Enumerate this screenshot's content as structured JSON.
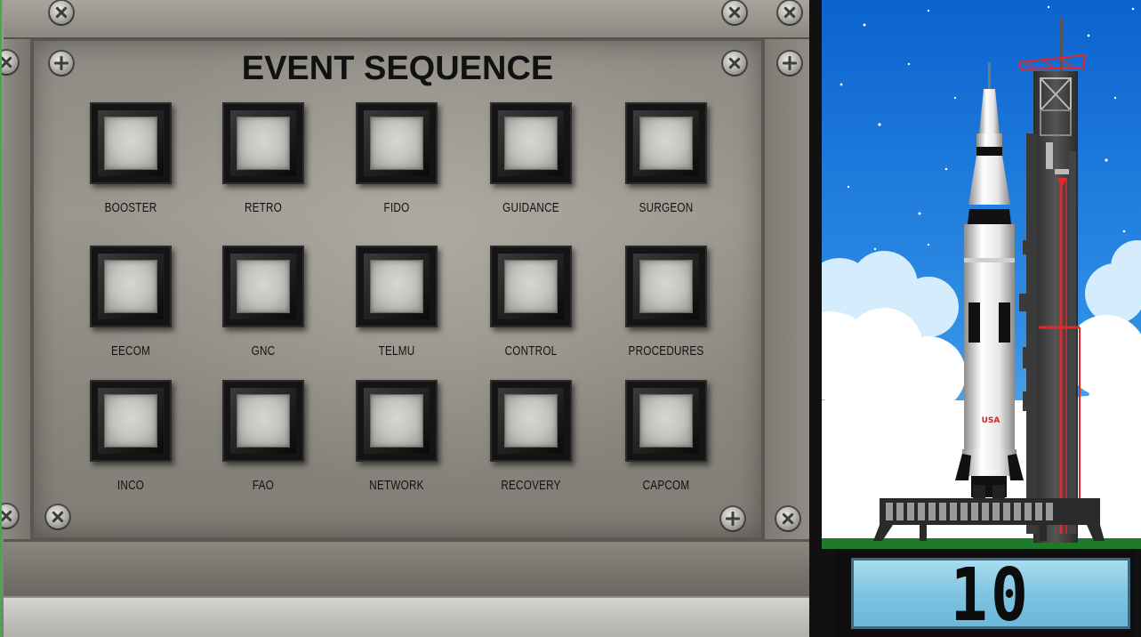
{
  "panel": {
    "title": "EVENT SEQUENCE",
    "buttons": [
      {
        "label": "BOOSTER"
      },
      {
        "label": "RETRO"
      },
      {
        "label": "FIDO"
      },
      {
        "label": "GUIDANCE"
      },
      {
        "label": "SURGEON"
      },
      {
        "label": "EECOM"
      },
      {
        "label": "GNC"
      },
      {
        "label": "TELMU"
      },
      {
        "label": "CONTROL"
      },
      {
        "label": "PROCEDURES"
      },
      {
        "label": "INCO"
      },
      {
        "label": "FAO"
      },
      {
        "label": "NETWORK"
      },
      {
        "label": "RECOVERY"
      },
      {
        "label": "CAPCOM"
      }
    ]
  },
  "launch_view": {
    "rocket_marking": "USA",
    "countdown": "10"
  },
  "colors": {
    "sky_top": "#0d6fd8",
    "sky_bottom": "#6ab5ee",
    "ground": "#1e7a2a",
    "tower_accent": "#e02a2a",
    "countdown_screen": "#7fc4e2"
  }
}
